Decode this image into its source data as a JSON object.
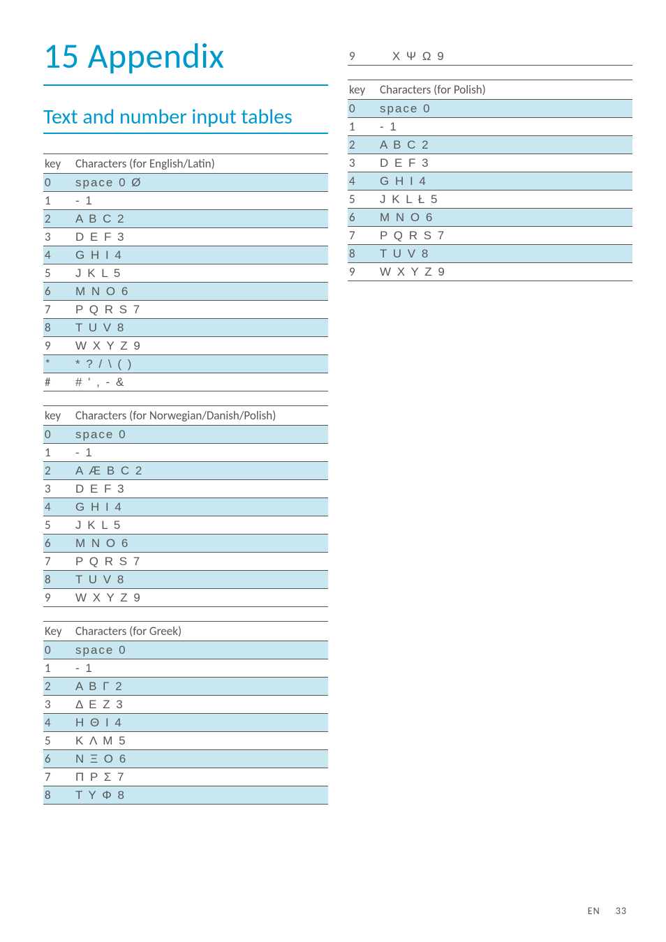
{
  "chapter": {
    "number": "15",
    "title": "Appendix"
  },
  "section": {
    "title": "Text and number input tables"
  },
  "tables": {
    "english": {
      "header_key": "key",
      "header_chars": "Characters (for English/Latin)",
      "rows": [
        {
          "k": "0",
          "v": "space 0 Ø",
          "shade": true
        },
        {
          "k": "1",
          "v": "- 1",
          "shade": false
        },
        {
          "k": "2",
          "v": "A B C 2",
          "shade": true
        },
        {
          "k": "3",
          "v": "D E F 3",
          "shade": false
        },
        {
          "k": "4",
          "v": "G H I 4",
          "shade": true
        },
        {
          "k": "5",
          "v": "J K L 5",
          "shade": false
        },
        {
          "k": "6",
          "v": "M N O 6",
          "shade": true
        },
        {
          "k": "7",
          "v": "P Q R S 7",
          "shade": false
        },
        {
          "k": "8",
          "v": "T U V 8",
          "shade": true
        },
        {
          "k": "9",
          "v": "W X Y Z 9",
          "shade": false
        },
        {
          "k": "*",
          "v": "* ? / \\ ( )",
          "shade": true
        },
        {
          "k": "#",
          "v": "# ' , - &",
          "shade": false
        }
      ]
    },
    "norwegian": {
      "header_key": "key",
      "header_chars": "Characters (for Norwegian/Danish/Polish)",
      "rows": [
        {
          "k": "0",
          "v": "space 0",
          "shade": true
        },
        {
          "k": "1",
          "v": "- 1",
          "shade": false
        },
        {
          "k": "2",
          "v": "A Æ B C 2",
          "shade": true
        },
        {
          "k": "3",
          "v": "D E F 3",
          "shade": false
        },
        {
          "k": "4",
          "v": "G H I 4",
          "shade": true
        },
        {
          "k": "5",
          "v": "J K L 5",
          "shade": false
        },
        {
          "k": "6",
          "v": "M N O 6",
          "shade": true
        },
        {
          "k": "7",
          "v": "P Q R S 7",
          "shade": false
        },
        {
          "k": "8",
          "v": "T U V 8",
          "shade": true
        },
        {
          "k": "9",
          "v": "W X Y Z 9",
          "shade": false
        }
      ]
    },
    "greek": {
      "header_key": "Key",
      "header_chars": "Characters (for Greek)",
      "rows": [
        {
          "k": "0",
          "v": "space 0",
          "shade": true
        },
        {
          "k": "1",
          "v": "- 1",
          "shade": false
        },
        {
          "k": "2",
          "v": "A B Γ 2",
          "shade": true
        },
        {
          "k": "3",
          "v": "Δ E Z 3",
          "shade": false
        },
        {
          "k": "4",
          "v": "H Θ I 4",
          "shade": true
        },
        {
          "k": "5",
          "v": "K Λ M 5",
          "shade": false
        },
        {
          "k": "6",
          "v": "N Ξ O 6",
          "shade": true
        },
        {
          "k": "7",
          "v": "Π P Σ 7",
          "shade": false
        },
        {
          "k": "8",
          "v": "T Y Φ 8",
          "shade": true
        }
      ]
    },
    "greek_cont": {
      "rows": [
        {
          "k": "9",
          "v": "X Ψ Ω 9",
          "shade": false
        }
      ]
    },
    "polish": {
      "header_key": "key",
      "header_chars": "Characters (for Polish)",
      "rows": [
        {
          "k": "0",
          "v": "space 0",
          "shade": true
        },
        {
          "k": "1",
          "v": "- 1",
          "shade": false
        },
        {
          "k": "2",
          "v": "A B C 2",
          "shade": true
        },
        {
          "k": "3",
          "v": "D E F 3",
          "shade": false
        },
        {
          "k": "4",
          "v": "G H I 4",
          "shade": true
        },
        {
          "k": "5",
          "v": "J K L Ł 5",
          "shade": false
        },
        {
          "k": "6",
          "v": "M N O 6",
          "shade": true
        },
        {
          "k": "7",
          "v": "P Q R S 7",
          "shade": false
        },
        {
          "k": "8",
          "v": "T U V 8",
          "shade": true
        },
        {
          "k": "9",
          "v": "W X Y Z 9",
          "shade": false
        }
      ]
    }
  },
  "footer": {
    "lang": "EN",
    "page": "33"
  }
}
